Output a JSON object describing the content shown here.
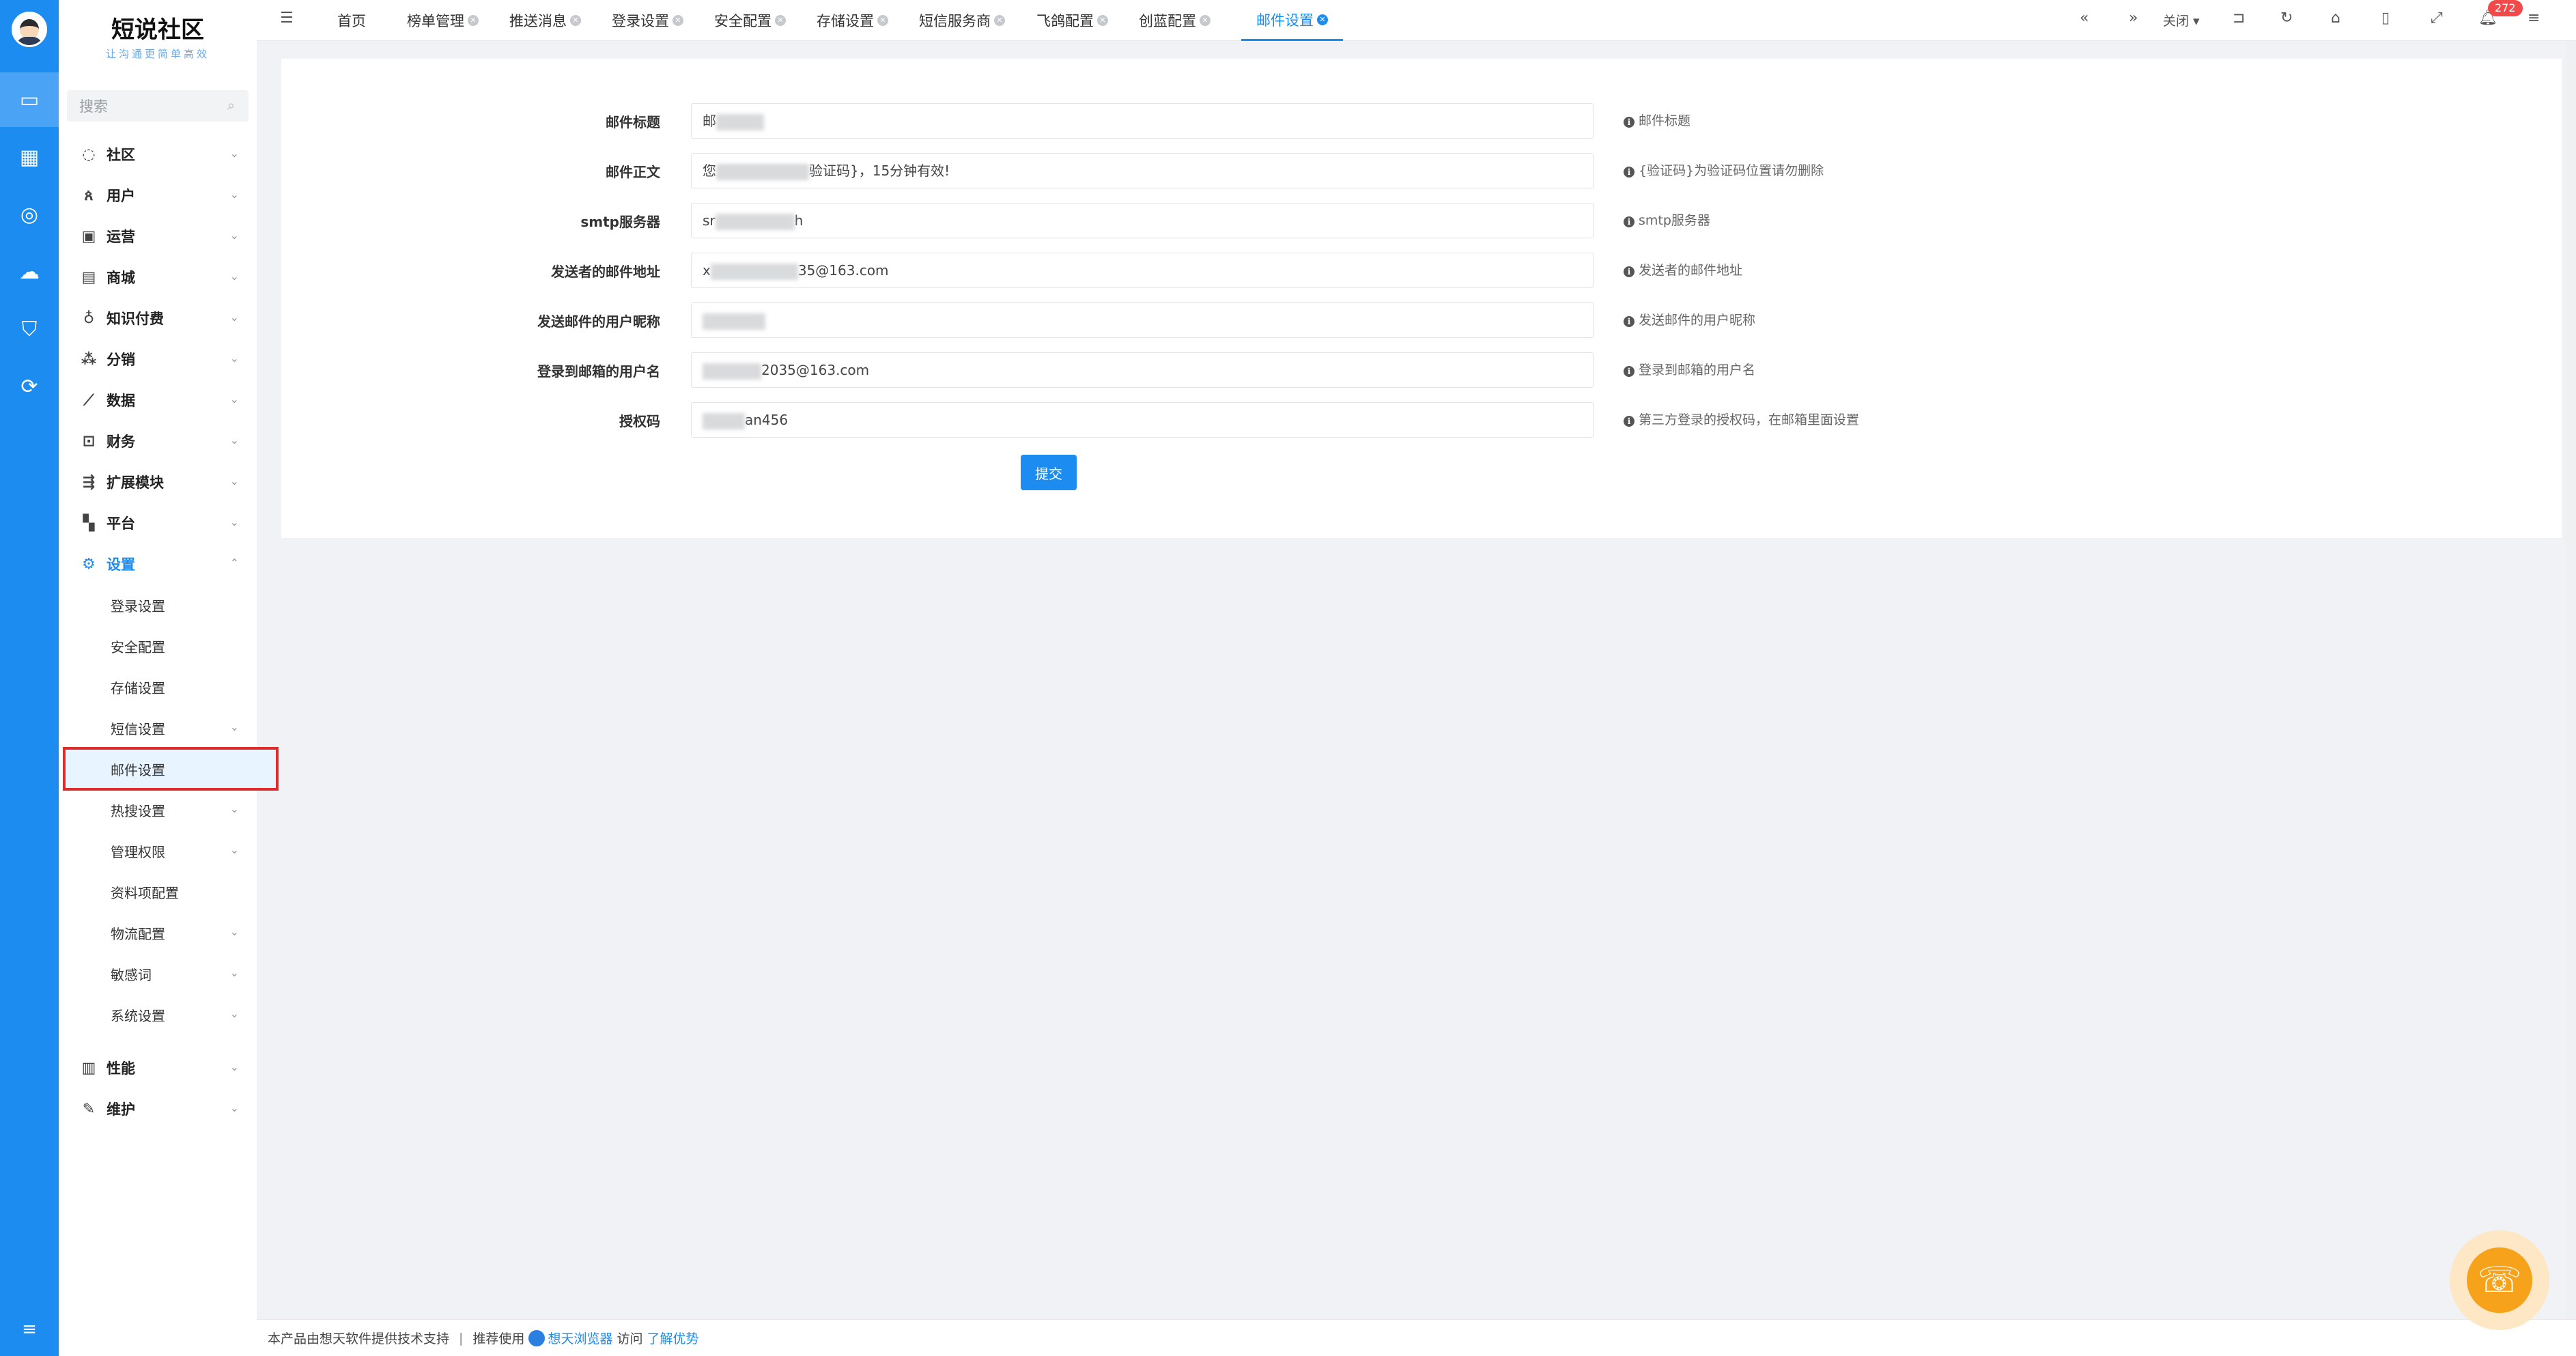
{
  "rail": {
    "icons": [
      "monitor-icon",
      "grid-icon",
      "globe-icon",
      "cloud-icon",
      "shield-check-icon",
      "cloud-sync-icon"
    ],
    "bottom_icon": "list-toggle-icon"
  },
  "brand": {
    "title": "短说社区",
    "slogan": "让沟通更简单高效"
  },
  "search": {
    "placeholder": "搜索"
  },
  "menu": {
    "items": [
      {
        "label": "社区",
        "icon": "chat-bubble-icon"
      },
      {
        "label": "用户",
        "icon": "users-icon"
      },
      {
        "label": "运营",
        "icon": "monitor-chart-icon"
      },
      {
        "label": "商城",
        "icon": "store-icon"
      },
      {
        "label": "知识付费",
        "icon": "lightbulb-icon"
      },
      {
        "label": "分销",
        "icon": "network-icon"
      },
      {
        "label": "数据",
        "icon": "line-chart-icon"
      },
      {
        "label": "财务",
        "icon": "finance-icon"
      },
      {
        "label": "扩展模块",
        "icon": "extension-icon"
      },
      {
        "label": "平台",
        "icon": "platform-icon"
      },
      {
        "label": "设置",
        "icon": "settings-gear-icon"
      }
    ],
    "settings_subs": [
      {
        "label": "登录设置"
      },
      {
        "label": "安全配置"
      },
      {
        "label": "存储设置"
      },
      {
        "label": "短信设置"
      },
      {
        "label": "邮件设置"
      },
      {
        "label": "热搜设置"
      },
      {
        "label": "管理权限"
      },
      {
        "label": "资料项配置"
      },
      {
        "label": "物流配置"
      },
      {
        "label": "敏感词"
      },
      {
        "label": "系统设置"
      }
    ],
    "bottom_items": [
      {
        "label": "性能",
        "icon": "document-icon"
      },
      {
        "label": "维护",
        "icon": "wrench-icon"
      }
    ]
  },
  "tabs": {
    "items": [
      "首页",
      "榜单管理",
      "推送消息",
      "登录设置",
      "安全配置",
      "存储设置",
      "短信服务商",
      "飞鸽配置",
      "创蓝配置",
      "邮件设置"
    ],
    "active": "邮件设置",
    "close_label": "关闭",
    "badge_count": "272"
  },
  "form": {
    "fields": [
      {
        "label": "邮件标题",
        "value_prefix": "邮",
        "value_suffix": "",
        "tip": "邮件标题"
      },
      {
        "label": "邮件正文",
        "value_prefix": "您",
        "value_suffix": "验证码}，15分钟有效!",
        "tip": "{验证码}为验证码位置请勿删除"
      },
      {
        "label": "smtp服务器",
        "value_prefix": "sr",
        "value_suffix": "h",
        "tip": "smtp服务器"
      },
      {
        "label": "发送者的邮件地址",
        "value_prefix": "x",
        "value_suffix": "35@163.com",
        "tip": "发送者的邮件地址"
      },
      {
        "label": "发送邮件的用户昵称",
        "value_prefix": "",
        "value_suffix": "",
        "tip": "发送邮件的用户昵称"
      },
      {
        "label": "登录到邮箱的用户名",
        "value_prefix": "",
        "value_suffix": "2035@163.com",
        "tip": "登录到邮箱的用户名"
      },
      {
        "label": "授权码",
        "value_prefix": "",
        "value_suffix": "an456",
        "tip": "第三方登录的授权码，在邮箱里面设置"
      }
    ],
    "submit_label": "提交"
  },
  "footer": {
    "support_text": "本产品由想天软件提供技术支持",
    "separator": "|",
    "recommend_text": "推荐使用",
    "browser_name": "想天浏览器",
    "visit_text": "访问",
    "learn_more": "了解优势"
  },
  "colors": {
    "primary": "#1d8cf0",
    "highlight_border": "#e02b2b",
    "badge": "#f04a4a",
    "support_bubble": "#f7a21b"
  }
}
